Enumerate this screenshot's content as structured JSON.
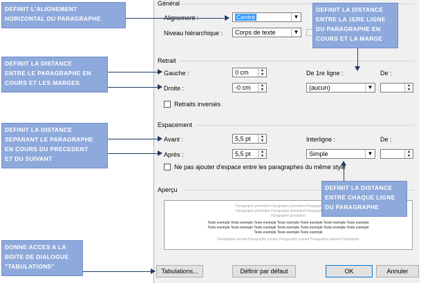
{
  "dialog": {
    "general": {
      "group_label": "Général",
      "alignment_label": "Alignement :",
      "alignment_value": "Centré",
      "level_label": "Niveau hiérarchique :",
      "level_value": "Corps de texte"
    },
    "indent": {
      "group_label": "Retrait",
      "left_label": "Gauche :",
      "left_value": "0 cm",
      "right_label": "Droite :",
      "right_value": "-0 cm",
      "first_line_label": "De 1re ligne :",
      "first_line_value": "(aucun)",
      "by_label": "De :",
      "by_value": "",
      "mirror_label": "Retraits inversés"
    },
    "spacing": {
      "group_label": "Espacement",
      "before_label": "Avant :",
      "before_value": "5,5 pt",
      "after_label": "Après :",
      "after_value": "5,5 pt",
      "line_label": "Interligne :",
      "line_value": "Simple",
      "at_label": "De :",
      "at_value": "",
      "no_space_label": "Ne pas ajouter d'espace entre les paragraphes du même style"
    },
    "preview": {
      "group_label": "Aperçu",
      "prev_lines": [
        "Paragraphe précédent Paragraphe précédent Paragraphe précédent",
        "Paragraphe précédent Paragraphe précédent Paragraphe précédent",
        "Paragraphe précédent"
      ],
      "sample_lines": [
        "Texte exemple Texte exemple Texte exemple Texte exemple Texte exemple Texte exemple Texte exemple",
        "Texte exemple Texte exemple Texte exemple Texte exemple Texte exemple Texte exemple Texte exemple",
        "Texte exemple Texte exemple Texte exemple"
      ],
      "next_lines": [
        "Paragraphe suivant Paragraphe suivant Paragraphe suivant Paragraphe suivant Paragraphe"
      ]
    },
    "buttons": {
      "tabs": "Tabulations...",
      "default": "Définir par défaut",
      "ok": "OK",
      "cancel": "Annuler"
    }
  },
  "notes": {
    "alignment": [
      "DEFINIT L'ALIGNEMENT",
      "HORIZONTAL DU PARAGRAPHE"
    ],
    "margins": [
      "DEFINIT LA DISTANCE",
      "ENTRE LE PARAGRAPHE EN",
      "COURS ET LES MARGES"
    ],
    "spacing": [
      "DEFINIT LA DISTANCE",
      "SEPARANT LE PARAGRAPHE",
      "EN COURS DU PRECEDENT",
      "ET DU SUIVANT"
    ],
    "tabs": [
      "DONNE ACCES A LA",
      "BOITE DE DIALOGUE",
      "\"TABULATIONS\""
    ],
    "first_line": [
      "DEFINIT LA DISTANCE",
      "ENTRE LA 1ERE LIGNE",
      "DU PARAGRAPHE EN",
      "COURS ET LA MARGE"
    ],
    "line_spacing": [
      "DEFINIT LA DISTANCE",
      "ENTRE CHAQUE LIGNE",
      "DU PARAGRAPHE"
    ]
  },
  "colors": {
    "note_bg": "#8ea9db",
    "arrow": "#1f3864",
    "selection": "#3399ff"
  }
}
